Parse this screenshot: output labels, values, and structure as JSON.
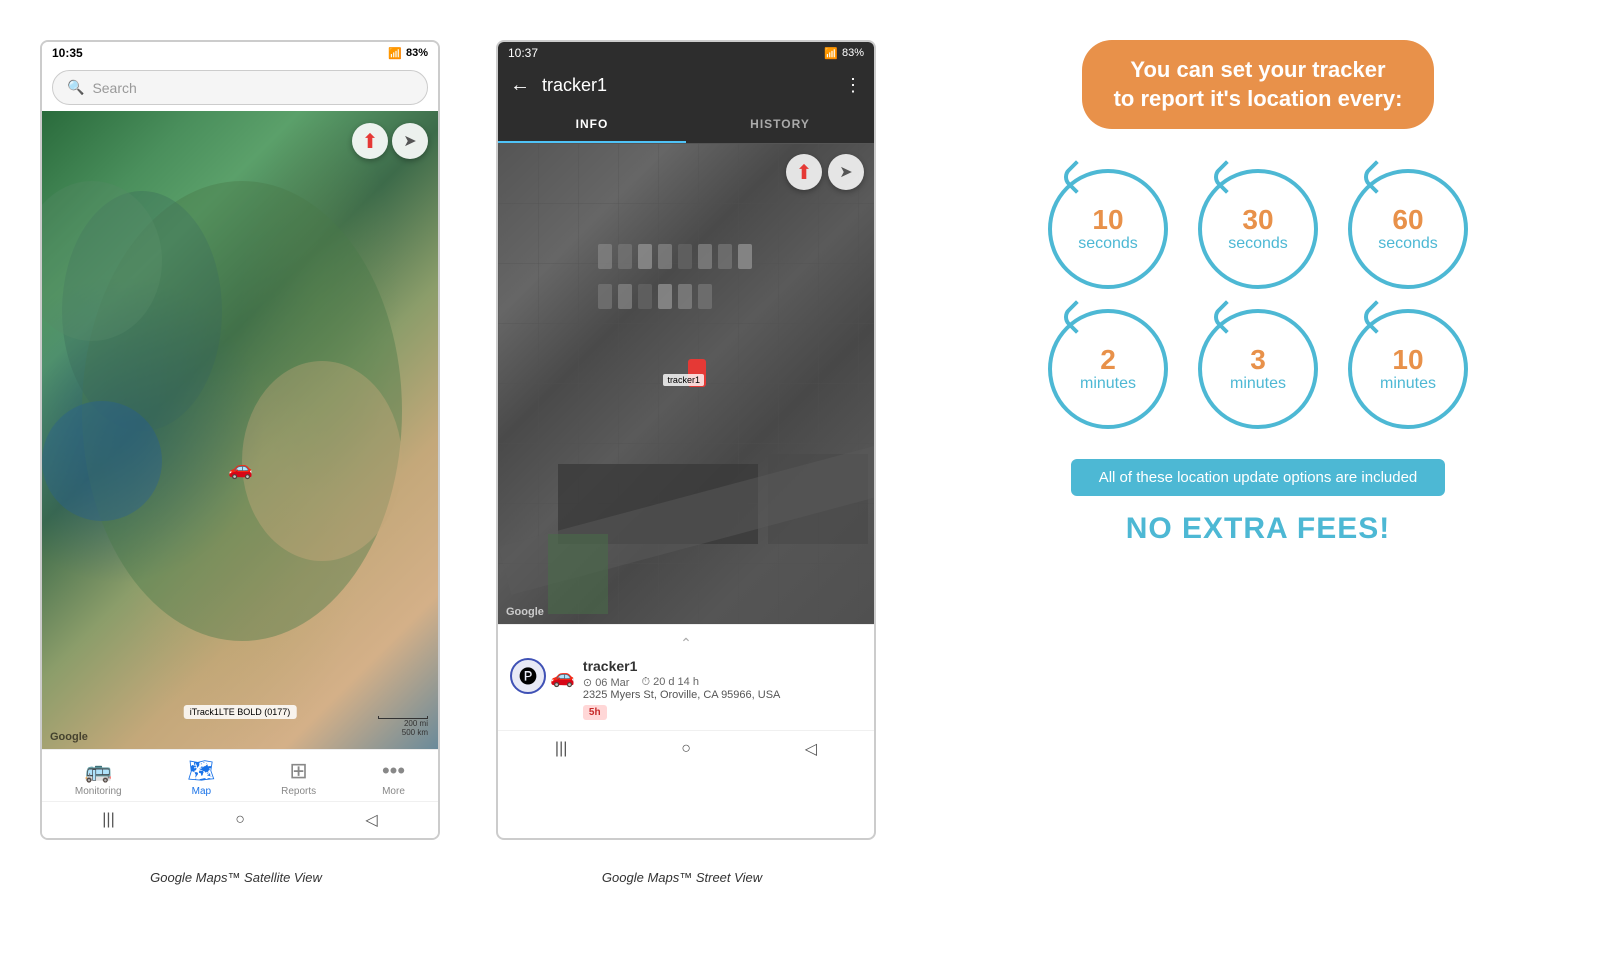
{
  "left_phone": {
    "status_time": "10:35",
    "status_signal": "▲.ull",
    "status_battery": "83%",
    "search_placeholder": "Search",
    "compass_icon": "⬆",
    "nav_icon": "➤",
    "tracker_label": "iTrack1LTE BOLD (0177)",
    "google_label": "Google",
    "scale_label_mi": "200 mi",
    "scale_label_km": "500 km",
    "nav_items": [
      {
        "label": "Monitoring",
        "icon": "🚌",
        "active": false
      },
      {
        "label": "Map",
        "icon": "🗺",
        "active": true
      },
      {
        "label": "Reports",
        "icon": "⊞",
        "active": false
      },
      {
        "label": "More",
        "icon": "···",
        "active": false
      }
    ],
    "android_buttons": [
      "|||",
      "○",
      "◁"
    ]
  },
  "right_phone": {
    "status_time": "10:37",
    "status_signal": "▲.ull",
    "status_battery": "83%",
    "back_icon": "←",
    "tracker_name": "tracker1",
    "menu_icon": "⋮",
    "tabs": [
      {
        "label": "INFO",
        "active": true
      },
      {
        "label": "HISTORY",
        "active": false
      }
    ],
    "compass_icon": "⬆",
    "nav_icon": "➤",
    "google_label": "Google",
    "car_label": "tracker1",
    "tracker_info": {
      "name": "tracker1",
      "date": "06 Mar",
      "duration": "20 d 14 h",
      "address": "2325 Myers St, Oroville, CA 95966, USA",
      "badge": "5h"
    },
    "android_buttons": [
      "|||",
      "○",
      "◁"
    ]
  },
  "info_panel": {
    "headline": "You can set your tracker\nto report it's location every:",
    "intervals": [
      {
        "number": "10",
        "unit": "seconds"
      },
      {
        "number": "30",
        "unit": "seconds"
      },
      {
        "number": "60",
        "unit": "seconds"
      },
      {
        "number": "2",
        "unit": "minutes"
      },
      {
        "number": "3",
        "unit": "minutes"
      },
      {
        "number": "10",
        "unit": "minutes"
      }
    ],
    "banner_text": "All of these location update options are included",
    "no_extra_fees": "NO EXTRA FEES!"
  },
  "captions": {
    "left": "Google Maps™ Satellite View",
    "right": "Google Maps™ Street View"
  }
}
